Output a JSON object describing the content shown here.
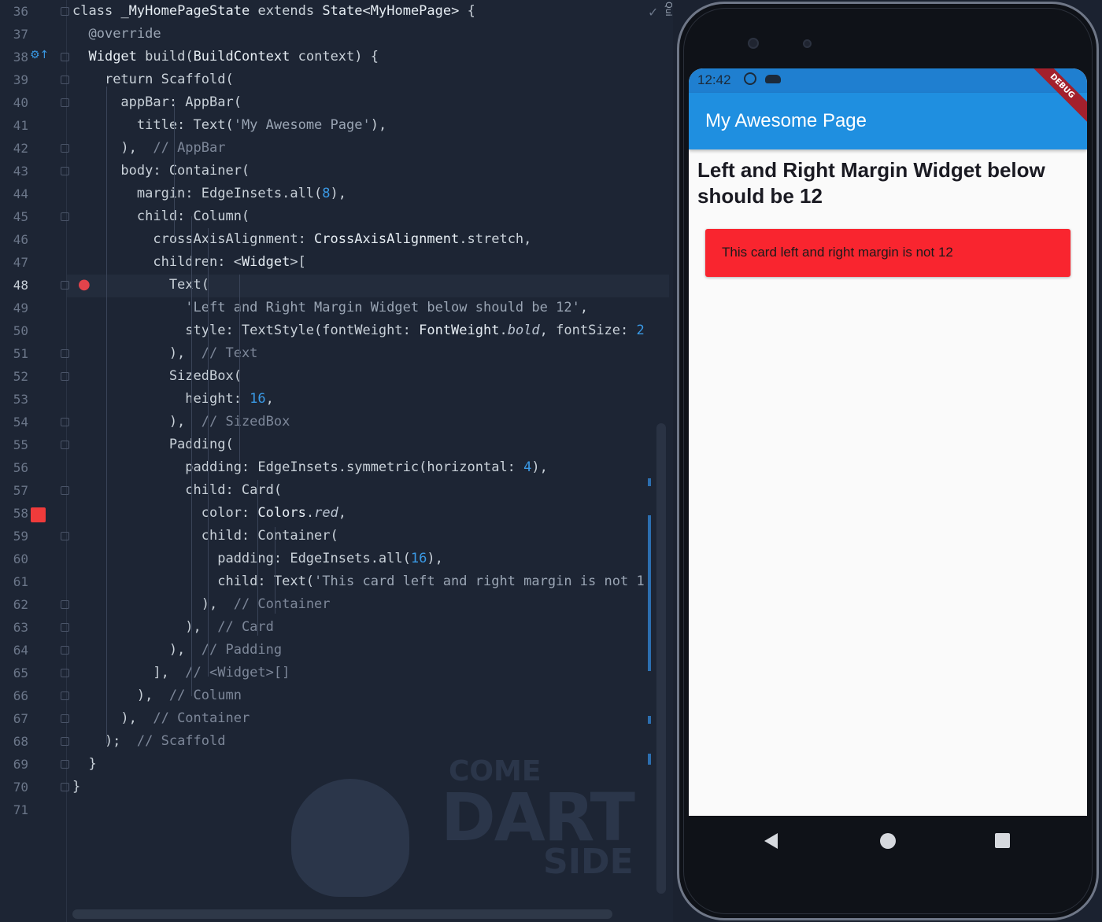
{
  "editor": {
    "lines": [
      {
        "n": "36",
        "html": "<span class='kw'>class</span> <span class='cls'>_MyHomePageState</span> <span class='kw'>extends</span> <span class='cls'>State&lt;MyHomePage&gt;</span> {"
      },
      {
        "n": "37",
        "html": "  <span class='ann'>@override</span>"
      },
      {
        "n": "38",
        "html": "  <span class='cls'>Widget</span> build(<span class='cls'>BuildContext</span> context) {"
      },
      {
        "n": "39",
        "html": "    <span class='kw'>return</span> Scaffold("
      },
      {
        "n": "40",
        "html": "      appBar: AppBar("
      },
      {
        "n": "41",
        "html": "        title: Text(<span class='str'>'My Awesome Page'</span>),"
      },
      {
        "n": "42",
        "html": "      ),  <span class='cmt'>// AppBar</span>"
      },
      {
        "n": "43",
        "html": "      body: Container("
      },
      {
        "n": "44",
        "html": "        margin: EdgeInsets.all(<span class='num'>8</span>),"
      },
      {
        "n": "45",
        "html": "        child: Column("
      },
      {
        "n": "46",
        "html": "          crossAxisAlignment: <span class='cls'>CrossAxisAlignment</span>.stretch,"
      },
      {
        "n": "47",
        "html": "          children: &lt;<span class='cls'>Widget</span>&gt;["
      },
      {
        "n": "48",
        "html": "            Text("
      },
      {
        "n": "49",
        "html": "              <span class='str'>'Left and Right Margin Widget below should be 12'</span>,"
      },
      {
        "n": "50",
        "html": "              style: TextStyle(fontWeight: <span class='cls'>FontWeight</span>.<span class='it'>bold</span>, fontSize: <span class='num'>2</span>"
      },
      {
        "n": "51",
        "html": "            ),  <span class='cmt'>// Text</span>"
      },
      {
        "n": "52",
        "html": "            SizedBox("
      },
      {
        "n": "53",
        "html": "              height: <span class='num'>16</span>,"
      },
      {
        "n": "54",
        "html": "            ),  <span class='cmt'>// SizedBox</span>"
      },
      {
        "n": "55",
        "html": "            Padding("
      },
      {
        "n": "56",
        "html": "              padding: EdgeInsets.symmetric(horizontal: <span class='num'>4</span>),"
      },
      {
        "n": "57",
        "html": "              child: Card("
      },
      {
        "n": "58",
        "html": "                color: <span class='cls'>Colors</span>.<span class='it'>red</span>,"
      },
      {
        "n": "59",
        "html": "                child: Container("
      },
      {
        "n": "60",
        "html": "                  padding: EdgeInsets.all(<span class='num'>16</span>),"
      },
      {
        "n": "61",
        "html": "                  child: Text(<span class='str'>'This card left and right margin is not 1</span>"
      },
      {
        "n": "62",
        "html": "                ),  <span class='cmt'>// Container</span>"
      },
      {
        "n": "63",
        "html": "              ),  <span class='cmt'>// Card</span>"
      },
      {
        "n": "64",
        "html": "            ),  <span class='cmt'>// Padding</span>"
      },
      {
        "n": "65",
        "html": "          ],  <span class='cmt'>// &lt;Widget&gt;[]</span>"
      },
      {
        "n": "66",
        "html": "        ),  <span class='cmt'>// Column</span>"
      },
      {
        "n": "67",
        "html": "      ),  <span class='cmt'>// Container</span>"
      },
      {
        "n": "68",
        "html": "    );  <span class='cmt'>// Scaffold</span>"
      },
      {
        "n": "69",
        "html": "  }"
      },
      {
        "n": "70",
        "html": "}"
      },
      {
        "n": "71",
        "html": ""
      }
    ],
    "active_line": "48",
    "icons": {
      "breakpoint": "breakpoint-icon",
      "bulb": "lightbulb-icon",
      "override": "override-icon",
      "check": "check-icon"
    },
    "watermark": {
      "top": "COME",
      "main": "DART",
      "bottom": "SIDE"
    }
  },
  "phone": {
    "status_time": "12:42",
    "debug_banner": "DEBUG",
    "app_title": "My Awesome Page",
    "heading": "Left and Right Margin Widget below should be 12",
    "card_text": "This card left and right margin is not 12",
    "card_color": "#f9252f",
    "appbar_color": "#1f8fe0",
    "nav": [
      "back",
      "home",
      "recents"
    ]
  }
}
